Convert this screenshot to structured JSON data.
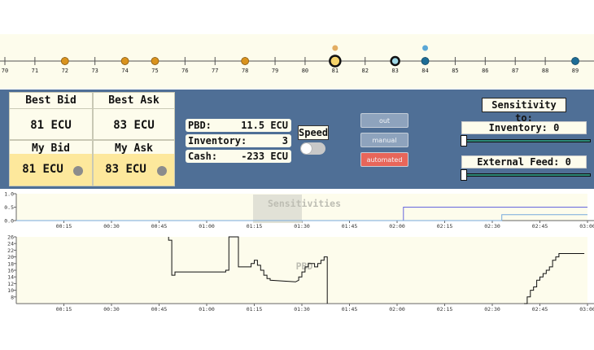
{
  "axis": {
    "ticks": [
      "70",
      "71",
      "72",
      "73",
      "74",
      "75",
      "76",
      "77",
      "78",
      "79",
      "80",
      "81",
      "82",
      "83",
      "84",
      "85",
      "86",
      "87",
      "88",
      "89"
    ],
    "bid_dots": [
      "72",
      "74",
      "75",
      "78"
    ],
    "ask_dots": [
      "84",
      "89"
    ],
    "my_bid_marker": "81",
    "my_ask_marker": "83",
    "extra_orange_dot": "81",
    "extra_blue_dot": "84"
  },
  "quotes": {
    "best_bid_label": "Best Bid",
    "best_bid_value": "81 ECU",
    "best_ask_label": "Best Ask",
    "best_ask_value": "83 ECU",
    "my_bid_label": "My Bid",
    "my_bid_value": "81 ECU",
    "my_ask_label": "My Ask",
    "my_ask_value": "83 ECU"
  },
  "stats": {
    "pbd_label": "PBD:",
    "pbd_value": "11.5 ECU",
    "inventory_label": "Inventory:",
    "inventory_value": "3",
    "cash_label": "Cash:",
    "cash_value": "-233 ECU"
  },
  "speed": {
    "label": "Speed",
    "on": false
  },
  "modes": {
    "out": "out",
    "manual": "manual",
    "automated": "automated",
    "active": "automated"
  },
  "sensitivity": {
    "title": "Sensitivity to:",
    "inventory_label": "Inventory: 0",
    "inventory_value": 0,
    "external_label": "External Feed: 0",
    "external_value": 0
  },
  "chart_data": [
    {
      "type": "line",
      "title": "Sensitivities",
      "ylim": [
        0,
        1
      ],
      "y_ticks": [
        "1.0",
        "0.5",
        "0.0"
      ],
      "x_ticks": [
        "00:15",
        "00:30",
        "00:45",
        "01:00",
        "01:15",
        "01:30",
        "01:45",
        "02:00",
        "02:15",
        "02:30",
        "02:45",
        "03:00"
      ],
      "series": [
        {
          "points": [
            [
              "00:00",
              0
            ],
            [
              "02:02",
              0
            ],
            [
              "02:02",
              0.5
            ],
            [
              "03:00",
              0.5
            ]
          ],
          "color": "#6666dd"
        },
        {
          "points": [
            [
              "00:00",
              0
            ],
            [
              "02:33",
              0
            ],
            [
              "02:33",
              0.22
            ],
            [
              "03:00",
              0.22
            ]
          ],
          "color": "#77aadd"
        }
      ]
    },
    {
      "type": "line",
      "title": "PBD",
      "ylim": [
        6,
        26
      ],
      "y_ticks": [
        "26",
        "24",
        "22",
        "20",
        "18",
        "16",
        "14",
        "12",
        "10",
        "8"
      ],
      "x_ticks": [
        "00:15",
        "00:30",
        "00:45",
        "01:00",
        "01:15",
        "01:30",
        "01:45",
        "02:00",
        "02:15",
        "02:30",
        "02:45",
        "03:00"
      ],
      "series": [
        {
          "color": "#111111",
          "points": [
            [
              "00:48",
              26
            ],
            [
              "00:48",
              25
            ],
            [
              "00:49",
              25
            ],
            [
              "00:49",
              14.5
            ],
            [
              "00:50",
              14.5
            ],
            [
              "00:50",
              15.5
            ],
            [
              "00:57",
              15.5
            ],
            [
              "01:06",
              15.5
            ],
            [
              "01:06",
              16
            ],
            [
              "01:07",
              16
            ],
            [
              "01:07",
              26
            ],
            [
              "01:10",
              26
            ],
            [
              "01:10",
              17
            ],
            [
              "01:14",
              17
            ],
            [
              "01:14",
              18
            ],
            [
              "01:15",
              18
            ],
            [
              "01:15",
              19
            ],
            [
              "01:16",
              19
            ],
            [
              "01:16",
              17.5
            ],
            [
              "01:17",
              17.5
            ],
            [
              "01:17",
              16
            ],
            [
              "01:18",
              16
            ],
            [
              "01:18",
              14.5
            ],
            [
              "01:19",
              14.5
            ],
            [
              "01:19",
              13.5
            ],
            [
              "01:20",
              13.5
            ],
            [
              "01:20",
              13
            ],
            [
              "01:28",
              12.5
            ],
            [
              "01:29",
              13
            ],
            [
              "01:29",
              14
            ],
            [
              "01:30",
              14
            ],
            [
              "01:30",
              15.5
            ],
            [
              "01:31",
              15.5
            ],
            [
              "01:31",
              17
            ],
            [
              "01:32",
              17
            ],
            [
              "01:32",
              18
            ],
            [
              "01:34",
              18
            ],
            [
              "01:34",
              17
            ],
            [
              "01:35",
              17
            ],
            [
              "01:35",
              18
            ],
            [
              "01:36",
              18
            ],
            [
              "01:36",
              19
            ],
            [
              "01:37",
              19
            ],
            [
              "01:37",
              20
            ],
            [
              "01:38",
              20
            ],
            [
              "01:38",
              6
            ]
          ]
        },
        {
          "color": "#111111",
          "points": [
            [
              "02:40",
              6
            ],
            [
              "02:41",
              6
            ],
            [
              "02:41",
              8
            ],
            [
              "02:42",
              8
            ],
            [
              "02:42",
              10
            ],
            [
              "02:43",
              10
            ],
            [
              "02:43",
              11
            ],
            [
              "02:44",
              11
            ],
            [
              "02:44",
              13
            ],
            [
              "02:45",
              13
            ],
            [
              "02:45",
              14
            ],
            [
              "02:46",
              14
            ],
            [
              "02:46",
              15
            ],
            [
              "02:47",
              15
            ],
            [
              "02:47",
              16
            ],
            [
              "02:48",
              16
            ],
            [
              "02:48",
              17
            ],
            [
              "02:49",
              17
            ],
            [
              "02:49",
              19
            ],
            [
              "02:50",
              19
            ],
            [
              "02:50",
              20
            ],
            [
              "02:51",
              20
            ],
            [
              "02:51",
              21
            ],
            [
              "02:59",
              21
            ]
          ]
        }
      ]
    }
  ]
}
